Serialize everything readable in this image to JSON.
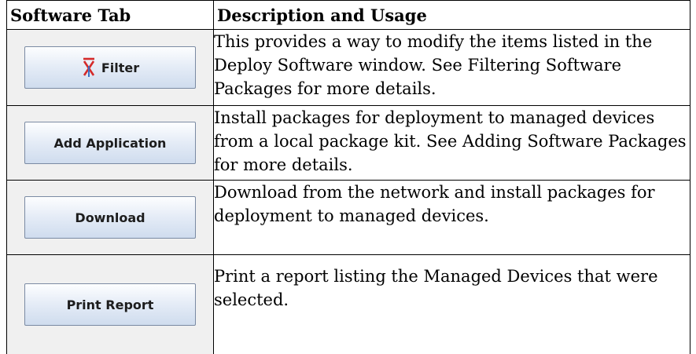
{
  "table": {
    "headers": [
      "Software Tab",
      "Description and Usage"
    ],
    "rows": [
      {
        "button_label": "Filter",
        "button_icon": "filter-icon",
        "description": "This provides a way to modify the items listed in the Deploy Software window. See Filtering Software Packages for more details."
      },
      {
        "button_label": "Add Application",
        "description": "Install packages for deployment to managed devices from a local package kit. See Adding Software Packages for more details."
      },
      {
        "button_label": "Download",
        "description": "Download from the network and install packages for deployment to managed devices."
      },
      {
        "button_label": "Print Report",
        "description": "Print a report listing the Managed Devices that were selected."
      }
    ]
  },
  "colors": {
    "filter_icon_red": "#d42a2a",
    "filter_icon_blue": "#3a6fc4"
  }
}
